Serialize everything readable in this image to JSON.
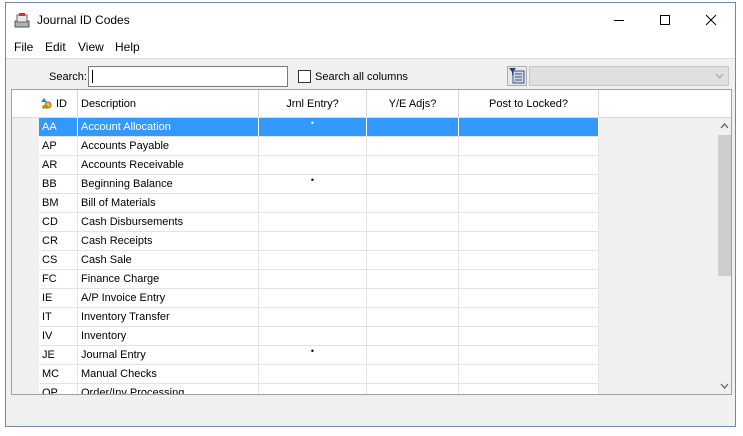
{
  "window": {
    "title": "Journal ID Codes"
  },
  "menu": [
    "File",
    "Edit",
    "View",
    "Help"
  ],
  "search": {
    "label": "Search:",
    "value": "",
    "checkbox_label": "Search all columns",
    "checked": false
  },
  "combo": {
    "value": ""
  },
  "columns": [
    "ID",
    "Description",
    "Jrnl Entry?",
    "Y/E Adjs?",
    "Post to Locked?"
  ],
  "rows": [
    {
      "id": "AA",
      "desc": "Account Allocation",
      "jrnl": "•",
      "ye": "",
      "locked": "",
      "selected": true
    },
    {
      "id": "AP",
      "desc": "Accounts Payable",
      "jrnl": "",
      "ye": "",
      "locked": ""
    },
    {
      "id": "AR",
      "desc": "Accounts Receivable",
      "jrnl": "",
      "ye": "",
      "locked": ""
    },
    {
      "id": "BB",
      "desc": "Beginning Balance",
      "jrnl": "•",
      "ye": "",
      "locked": ""
    },
    {
      "id": "BM",
      "desc": "Bill of Materials",
      "jrnl": "",
      "ye": "",
      "locked": ""
    },
    {
      "id": "CD",
      "desc": "Cash Disbursements",
      "jrnl": "",
      "ye": "",
      "locked": ""
    },
    {
      "id": "CR",
      "desc": "Cash Receipts",
      "jrnl": "",
      "ye": "",
      "locked": ""
    },
    {
      "id": "CS",
      "desc": "Cash Sale",
      "jrnl": "",
      "ye": "",
      "locked": ""
    },
    {
      "id": "FC",
      "desc": "Finance Charge",
      "jrnl": "",
      "ye": "",
      "locked": ""
    },
    {
      "id": "IE",
      "desc": "A/P Invoice Entry",
      "jrnl": "",
      "ye": "",
      "locked": ""
    },
    {
      "id": "IT",
      "desc": "Inventory Transfer",
      "jrnl": "",
      "ye": "",
      "locked": ""
    },
    {
      "id": "IV",
      "desc": "Inventory",
      "jrnl": "",
      "ye": "",
      "locked": ""
    },
    {
      "id": "JE",
      "desc": "Journal Entry",
      "jrnl": "•",
      "ye": "",
      "locked": ""
    },
    {
      "id": "MC",
      "desc": "Manual Checks",
      "jrnl": "",
      "ye": "",
      "locked": ""
    },
    {
      "id": "OP",
      "desc": "Order/Inv Processing",
      "jrnl": "",
      "ye": "",
      "locked": ""
    }
  ],
  "colors": {
    "selection": "#3399ff",
    "window_border": "#6e8aa6",
    "chrome": "#f0f0f0"
  }
}
